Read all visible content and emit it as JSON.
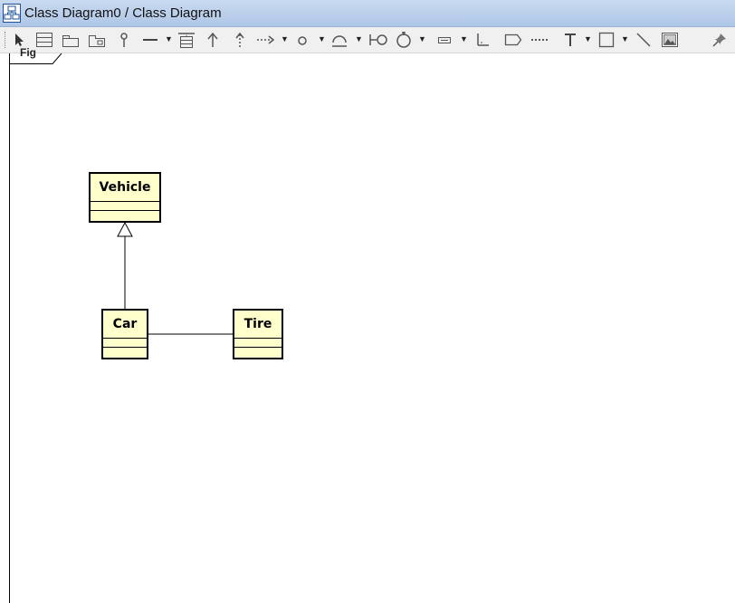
{
  "window": {
    "title": "Class Diagram0 / Class Diagram",
    "icon": "class-diagram-icon"
  },
  "toolbar": {
    "tools": [
      {
        "name": "select-pointer",
        "icon": "arrow-pointer-icon"
      },
      {
        "name": "class",
        "icon": "class-icon"
      },
      {
        "name": "package",
        "icon": "package-icon"
      },
      {
        "name": "subsystem",
        "icon": "subsystem-icon"
      },
      {
        "name": "interface",
        "icon": "lollipop-icon"
      },
      {
        "name": "association",
        "icon": "line-icon",
        "dropdown": true
      },
      {
        "name": "association-class",
        "icon": "association-class-icon"
      },
      {
        "name": "generalization",
        "icon": "generalization-arrow-icon"
      },
      {
        "name": "realization",
        "icon": "realization-arrow-icon"
      },
      {
        "name": "dependency",
        "icon": "dependency-arrow-icon",
        "dropdown": true
      },
      {
        "name": "n-ary",
        "icon": "small-circle-icon",
        "dropdown": true
      },
      {
        "name": "provided-interface",
        "icon": "provided-interface-icon",
        "dropdown": true
      },
      {
        "name": "required-interface",
        "icon": "socket-icon"
      },
      {
        "name": "containment",
        "icon": "containment-icon",
        "dropdown": true
      },
      {
        "name": "template",
        "icon": "template-icon",
        "dropdown": true
      },
      {
        "name": "anchor",
        "icon": "anchor-icon"
      },
      {
        "name": "note",
        "icon": "note-icon"
      },
      {
        "name": "note-anchor",
        "icon": "dotted-line-icon"
      },
      {
        "name": "text",
        "icon": "text-icon",
        "dropdown": true
      },
      {
        "name": "rectangle",
        "icon": "rectangle-icon",
        "dropdown": true
      },
      {
        "name": "line",
        "icon": "diagonal-line-icon"
      },
      {
        "name": "image",
        "icon": "image-icon"
      },
      {
        "name": "pin",
        "icon": "pin-icon"
      }
    ]
  },
  "diagram": {
    "frame_label": "Fig",
    "classes": [
      {
        "id": "vehicle",
        "name": "Vehicle"
      },
      {
        "id": "car",
        "name": "Car"
      },
      {
        "id": "tire",
        "name": "Tire"
      }
    ],
    "relationships": [
      {
        "type": "generalization",
        "from": "car",
        "to": "vehicle"
      },
      {
        "type": "association",
        "from": "car",
        "to": "tire"
      }
    ]
  },
  "colors": {
    "class_fill": "#ffffcc",
    "titlebar": "#b9cfeb"
  }
}
